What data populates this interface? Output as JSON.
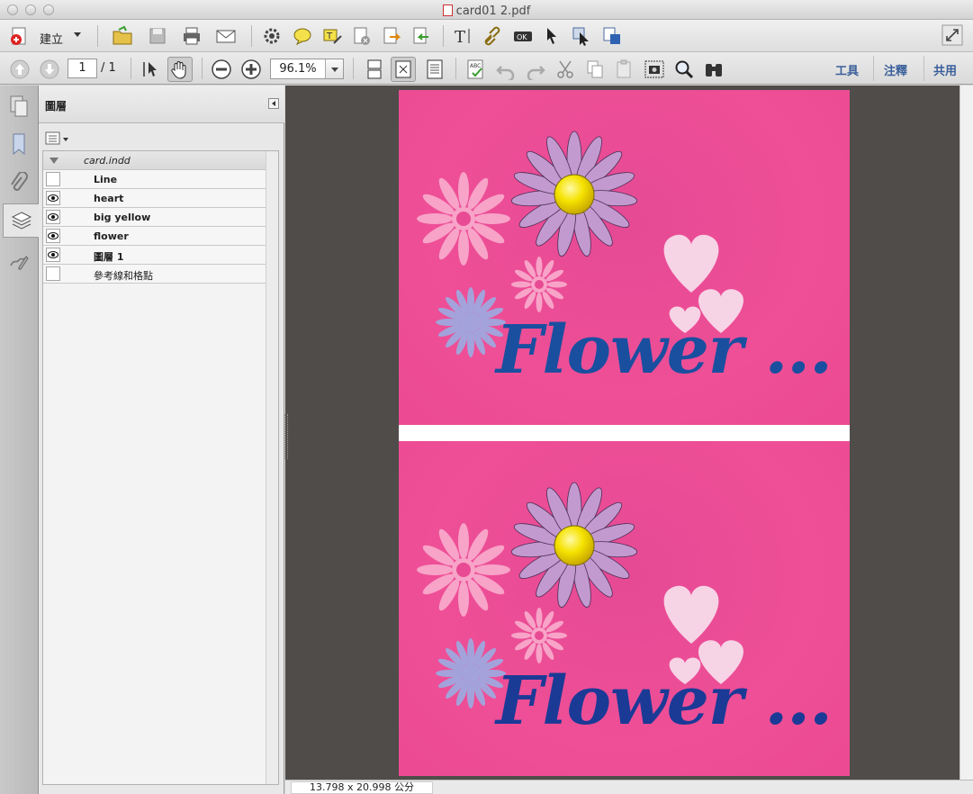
{
  "window": {
    "title": "card01 2.pdf"
  },
  "toolbar1": {
    "create_label": "建立",
    "icons": [
      "open-folder-icon",
      "save-icon",
      "print-icon",
      "email-icon",
      "gear-icon",
      "comment-icon",
      "highlight-icon",
      "stamp-icon",
      "export-icon",
      "import-icon",
      "text-tool-icon",
      "link-icon",
      "ok-button-icon",
      "select-cursor-icon",
      "object-select-icon",
      "touchup-icon",
      "fullscreen-icon"
    ]
  },
  "toolbar2": {
    "page_current": "1",
    "page_total": "/ 1",
    "zoom": "96.1%",
    "tools_label": "工具",
    "comment_label": "注釋",
    "share_label": "共用"
  },
  "panel": {
    "title": "圖層",
    "document": "card.indd",
    "layers": [
      {
        "label": "Line",
        "visible": false,
        "bold": true
      },
      {
        "label": "heart",
        "visible": true,
        "bold": true
      },
      {
        "label": "big yellow",
        "visible": true,
        "bold": true
      },
      {
        "label": "flower",
        "visible": true,
        "bold": true
      },
      {
        "label": "圖層 1",
        "visible": true,
        "bold": true
      },
      {
        "label": "參考線和格點",
        "visible": false,
        "bold": false
      }
    ]
  },
  "document": {
    "card_text_top": "Flower ...",
    "card_text_bottom": "Flower ...",
    "colors": {
      "card_pink": "#ec4b94",
      "text_blue": "#1a4fa0",
      "light_pink": "#f8a3c8",
      "lavender": "#c39ad0",
      "periwinkle": "#a4a2da",
      "yellow": "#f5e300",
      "heart": "#f7d3e6"
    }
  },
  "status": {
    "page_size": "13.798 x 20.998 公分"
  }
}
